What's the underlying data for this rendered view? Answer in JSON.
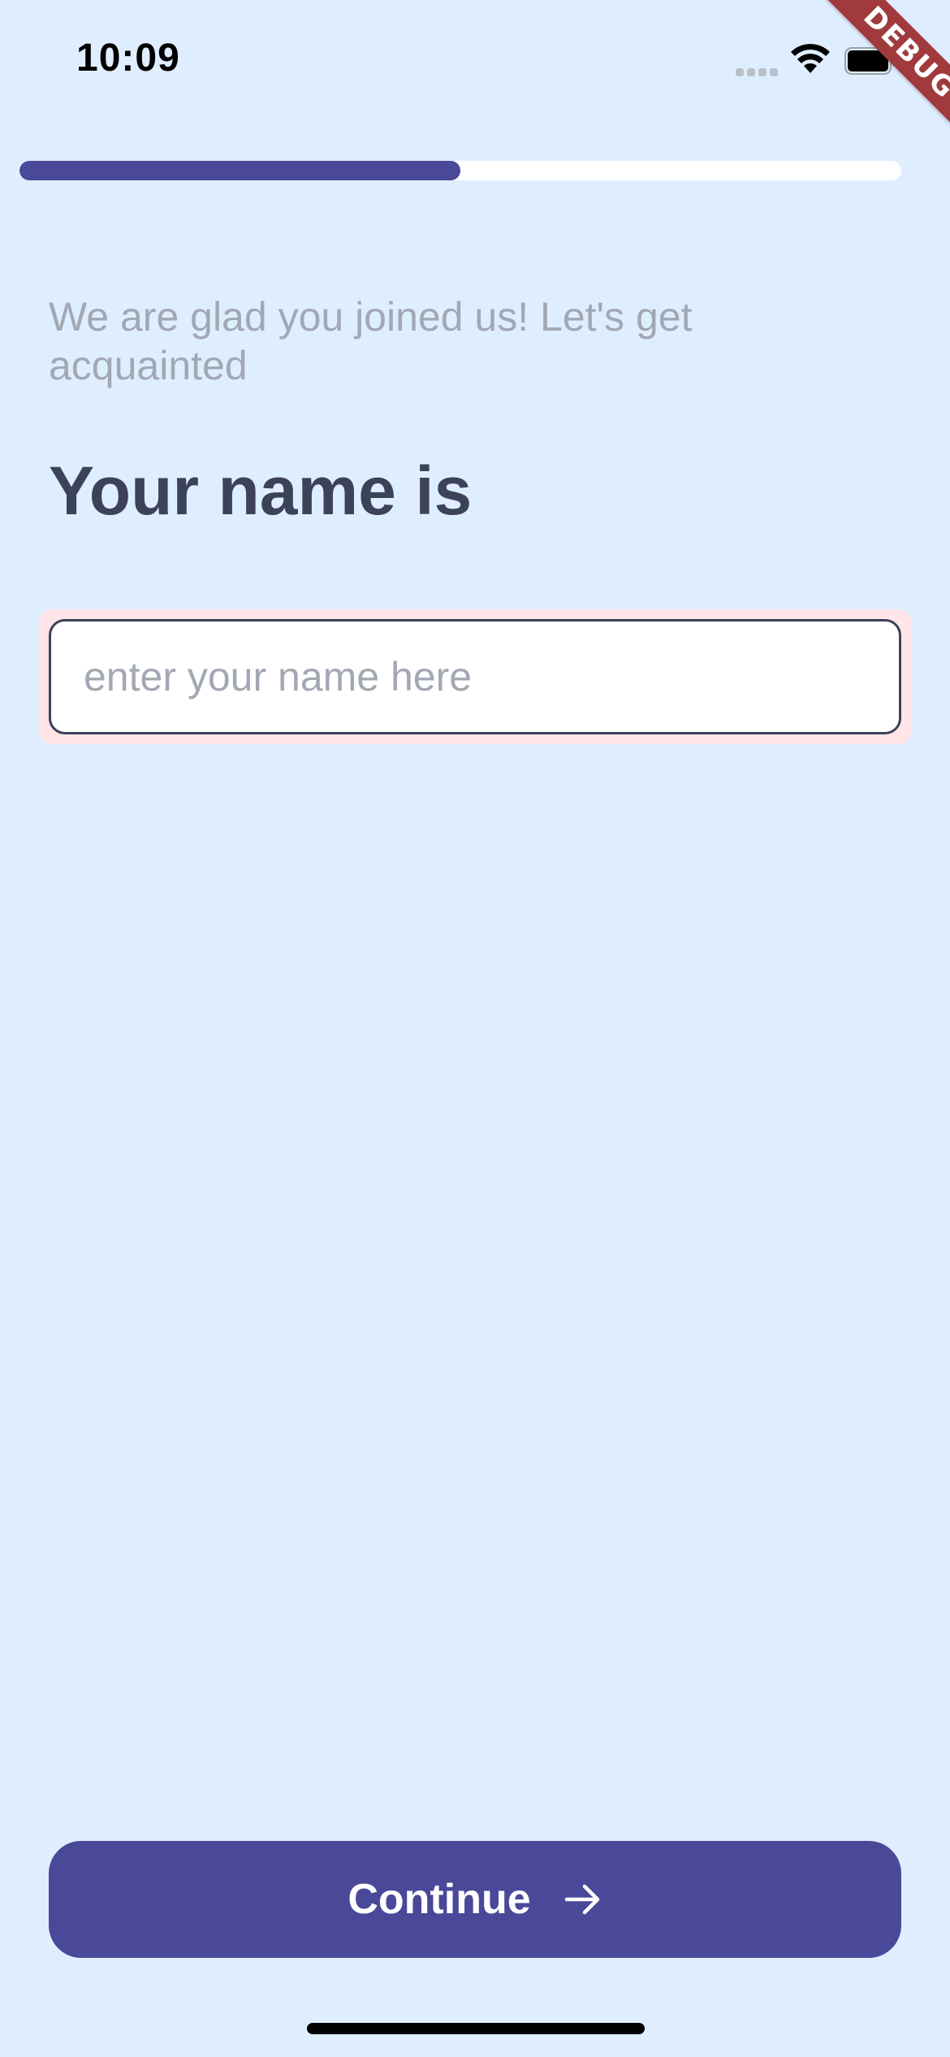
{
  "status_bar": {
    "time": "10:09"
  },
  "debug_banner": {
    "label": "DEBUG"
  },
  "progress": {
    "fraction": 0.5,
    "fill_color": "#4a4898",
    "track_color": "#ffffff"
  },
  "onboarding": {
    "subtitle": "We are glad you joined us! Let's get acquainted",
    "heading": "Your name is",
    "name_input": {
      "value": "",
      "placeholder": "enter your name here"
    },
    "continue_label": "Continue"
  },
  "icons": {
    "signal": "cellular-signal-icon",
    "wifi": "wifi-icon",
    "battery": "battery-icon",
    "arrow": "arrow-right-icon"
  },
  "colors": {
    "background": "#dfeeff",
    "primary": "#4a4898",
    "heading": "#3c4259",
    "muted_text": "#a2a8b3",
    "input_halo": "#ffe5e8",
    "debug": "#a03a3d"
  }
}
